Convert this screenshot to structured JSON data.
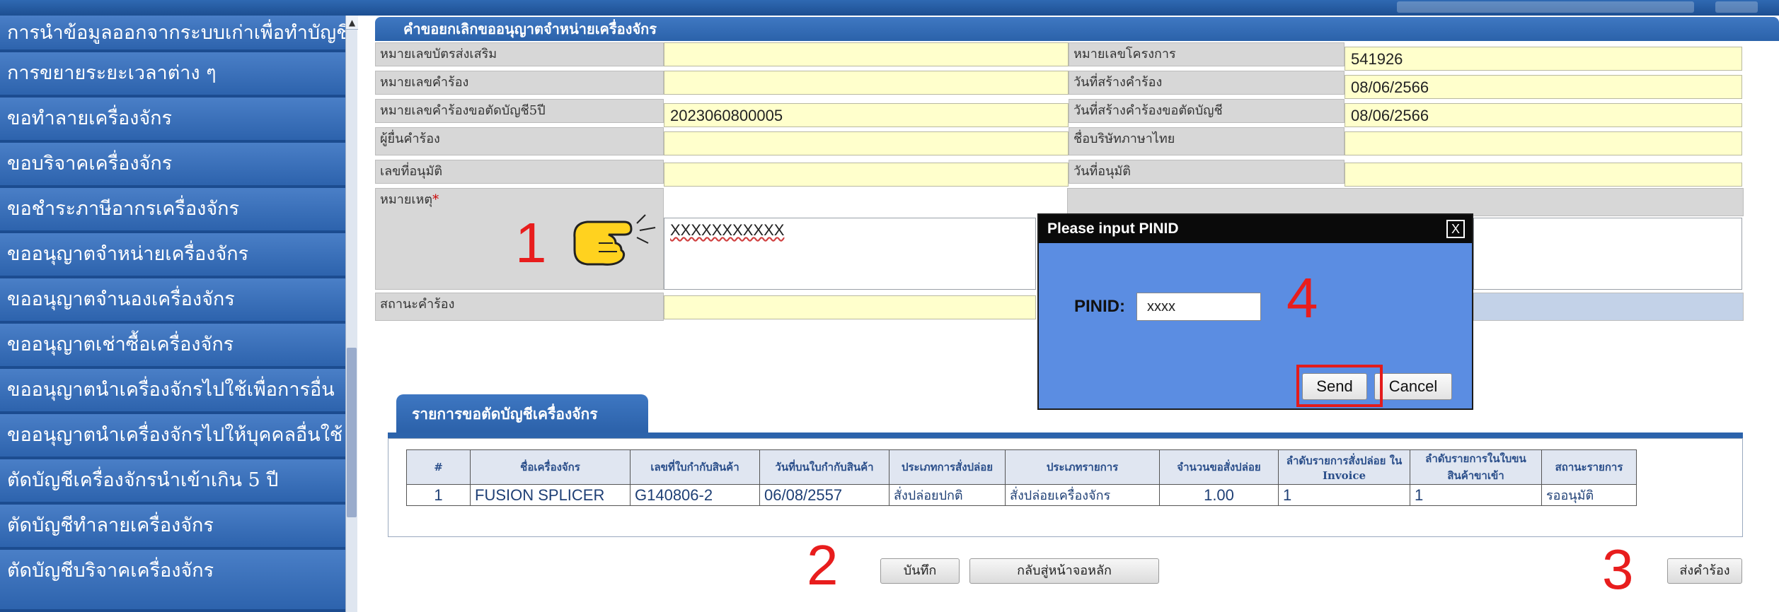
{
  "sidebar": {
    "items": [
      {
        "label": "การนำข้อมูลออกจากระบบเก่าเพื่อทำบัญชีใ"
      },
      {
        "label": "การขยายระยะเวลาต่าง ๆ"
      },
      {
        "label": "ขอทำลายเครื่องจักร"
      },
      {
        "label": "ขอบริจาคเครื่องจักร"
      },
      {
        "label": "ขอชำระภาษีอากรเครื่องจักร"
      },
      {
        "label": "ขออนุญาตจำหน่ายเครื่องจักร"
      },
      {
        "label": "ขออนุญาตจำนองเครื่องจักร"
      },
      {
        "label": "ขออนุญาตเช่าซื้อเครื่องจักร"
      },
      {
        "label": "ขออนุญาตนำเครื่องจักรไปใช้เพื่อการอื่น"
      },
      {
        "label": "ขออนุญาตนำเครื่องจักรไปให้บุคคลอื่นใช้"
      },
      {
        "label": "ตัดบัญชีเครื่องจักรนำเข้าเกิน 5 ปี"
      },
      {
        "label": "ตัดบัญชีทำลายเครื่องจักร"
      },
      {
        "label": "ตัดบัญชีบริจาคเครื่องจักร"
      }
    ]
  },
  "panel": {
    "title": "คำขอยกเลิกขออนุญาตจำหน่ายเครื่องจักร"
  },
  "form": {
    "promo_card_label": "หมายเลขบัตรส่งเสริม",
    "promo_card_value": "",
    "project_no_label": "หมายเลขโครงการ",
    "project_no_value": "541926",
    "request_no_label": "หมายเลขคำร้อง",
    "request_no_value": "",
    "request_created_label": "วันที่สร้างคำร้อง",
    "request_created_value": "08/06/2566",
    "cut_request_no_label": "หมายเลขคำร้องขอตัดบัญชี5ปี",
    "cut_request_no_value": "2023060800005",
    "cut_request_created_label": "วันที่สร้างคำร้องขอตัดบัญชี",
    "cut_request_created_value": "08/06/2566",
    "applicant_label": "ผู้ยื่นคำร้อง",
    "applicant_value": "",
    "company_th_label": "ชื่อบริษัทภาษาไทย",
    "company_th_value": "",
    "approval_no_label": "เลขที่อนุมัติ",
    "approval_no_value": "",
    "approval_date_label": "วันที่อนุมัติ",
    "approval_date_value": "",
    "remark_label": "หมายเหตุ",
    "remark_required": "*",
    "remark_value": "XXXXXXXXXXX",
    "status_label": "สถานะคำร้อง",
    "status_value": ""
  },
  "tab": {
    "label": "รายการขอตัดบัญชีเครื่องจักร"
  },
  "table": {
    "headers": [
      "#",
      "ชื่อเครื่องจักร",
      "เลขที่ใบกำกับสินค้า",
      "วันที่บนใบกำกับสินค้า",
      "ประเภทการสั่งปล่อย",
      "ประเภทรายการ",
      "จำนวนขอสั่งปล่อย",
      "ลำดับรายการสั่งปล่อย ใน Invoice",
      "ลำดับรายการในใบขน สินค้าขาเข้า",
      "สถานะรายการ"
    ],
    "rows": [
      {
        "no": "1",
        "machine": "FUSION SPLICER",
        "invoice_no": "G140806-2",
        "invoice_date": "06/08/2557",
        "release_type": "สั่งปล่อยปกติ",
        "item_type": "สั่งปล่อยเครื่องจักร",
        "qty": "1.00",
        "invoice_seq": "1",
        "import_seq": "1",
        "status": "รออนุมัติ"
      }
    ]
  },
  "buttons": {
    "save": "บันทึก",
    "back": "กลับสู่หน้าจอหลัก",
    "submit": "ส่งคำร้อง"
  },
  "dialog": {
    "title": "Please input PINID",
    "close": "X",
    "label": "PINID:",
    "input_value": "xxxx",
    "send": "Send",
    "cancel": "Cancel"
  },
  "annotations": {
    "step1": "1",
    "step2": "2",
    "step3": "3",
    "step4": "4"
  },
  "colors": {
    "sidebar_item": "#3a70bb",
    "panel_header": "#3570b8",
    "field_yellow": "#ffffcc",
    "dialog_bg": "#5b8de2",
    "marker_red": "#e81d1d"
  }
}
